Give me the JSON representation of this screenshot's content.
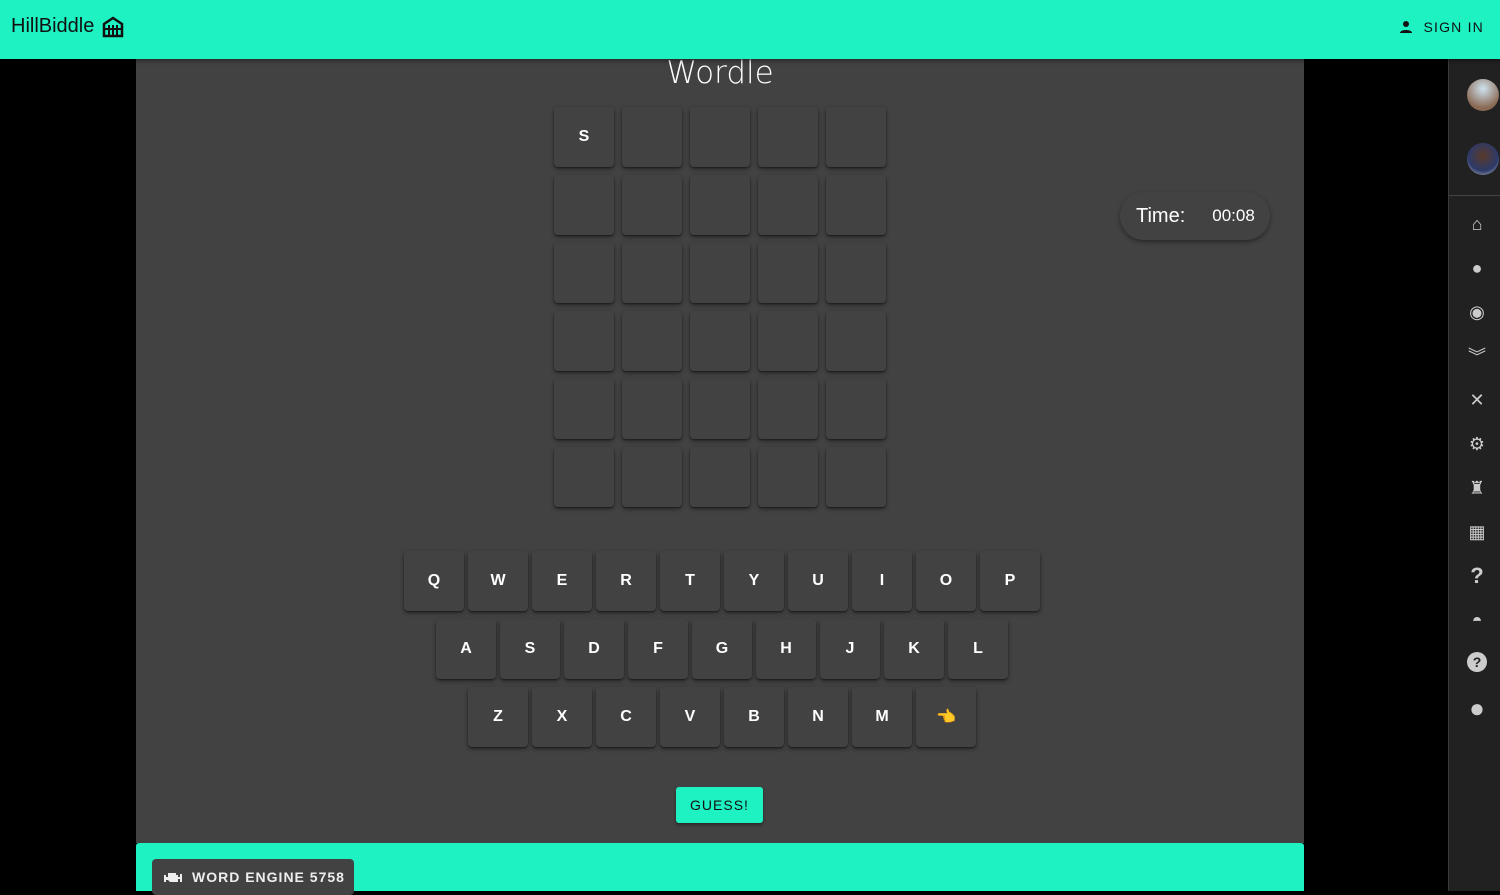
{
  "header": {
    "brand": "HillBiddle",
    "sign_in": "SIGN IN"
  },
  "game": {
    "title": "Wordle",
    "timer_label": "Time:",
    "timer_value": "00:08",
    "grid": [
      [
        "S",
        "",
        "",
        "",
        ""
      ],
      [
        "",
        "",
        "",
        "",
        ""
      ],
      [
        "",
        "",
        "",
        "",
        ""
      ],
      [
        "",
        "",
        "",
        "",
        ""
      ],
      [
        "",
        "",
        "",
        "",
        ""
      ],
      [
        "",
        "",
        "",
        "",
        ""
      ]
    ],
    "keyboard": [
      [
        "Q",
        "W",
        "E",
        "R",
        "T",
        "Y",
        "U",
        "I",
        "O",
        "P"
      ],
      [
        "A",
        "S",
        "D",
        "F",
        "G",
        "H",
        "J",
        "K",
        "L"
      ],
      [
        "Z",
        "X",
        "C",
        "V",
        "B",
        "N",
        "M",
        "👈"
      ]
    ],
    "guess_label": "GUESS!"
  },
  "footer": {
    "engine_label": "WORD ENGINE 5758"
  },
  "sidebar": {
    "icons": [
      "home-icon",
      "person-icon",
      "pumpkin-icon",
      "bat-icon",
      "crossed-swords-icon",
      "gear-icon",
      "trophy-icon",
      "keyboard-icon",
      "question-icon",
      "hat-icon",
      "help-circle-icon",
      "circle-icon"
    ]
  },
  "colors": {
    "accent": "#1ef2c2",
    "panel": "#424242",
    "sidebar": "#212121"
  }
}
